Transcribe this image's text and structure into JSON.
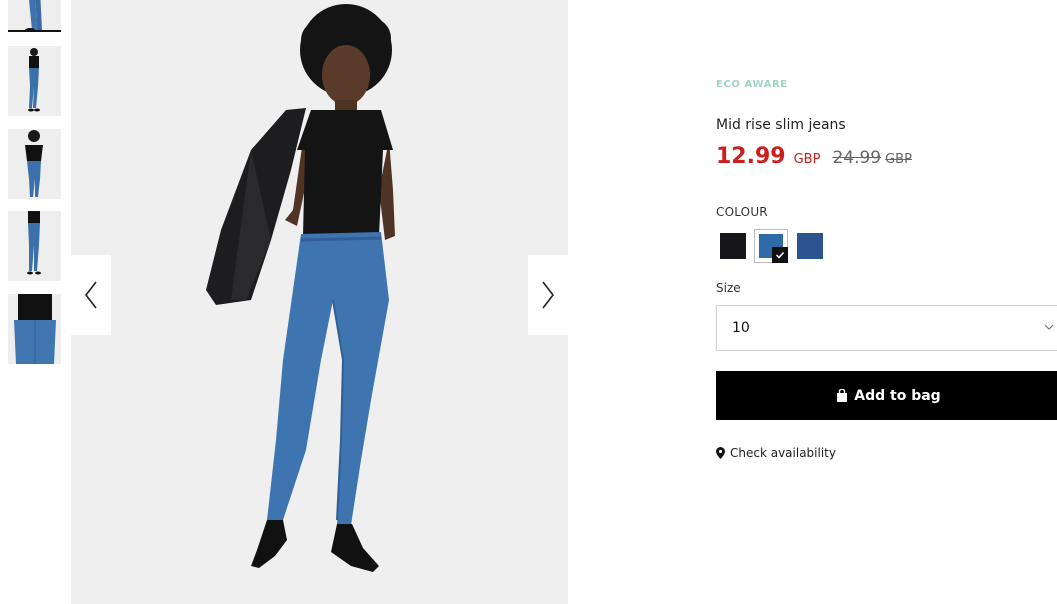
{
  "thumbnails": [
    {
      "name": "thumbnail-1",
      "active": true
    },
    {
      "name": "thumbnail-2",
      "active": false
    },
    {
      "name": "thumbnail-3",
      "active": false
    },
    {
      "name": "thumbnail-4",
      "active": false
    },
    {
      "name": "thumbnail-5",
      "active": false
    }
  ],
  "gallery": {
    "prev_icon": "chevron-left-icon",
    "next_icon": "chevron-right-icon"
  },
  "product": {
    "badge": "ECO AWARE",
    "title": "Mid rise slim jeans",
    "price_now": "12.99",
    "price_now_currency": "GBP",
    "price_old": "24.99",
    "price_old_currency": "GBP"
  },
  "colour": {
    "label": "COLOUR",
    "options": [
      {
        "name": "black",
        "hex": "#17171b",
        "selected": false
      },
      {
        "name": "mid-blue",
        "hex": "#2f6aa8",
        "selected": true
      },
      {
        "name": "dark-blue",
        "hex": "#2c5590",
        "selected": false
      }
    ]
  },
  "size": {
    "label": "Size",
    "selected": "10"
  },
  "actions": {
    "add_to_bag": "Add to bag",
    "check_availability": "Check availability"
  },
  "colors": {
    "price_red": "#cc1f1f",
    "eco_green": "#9fd4c5",
    "button_black": "#000000"
  }
}
